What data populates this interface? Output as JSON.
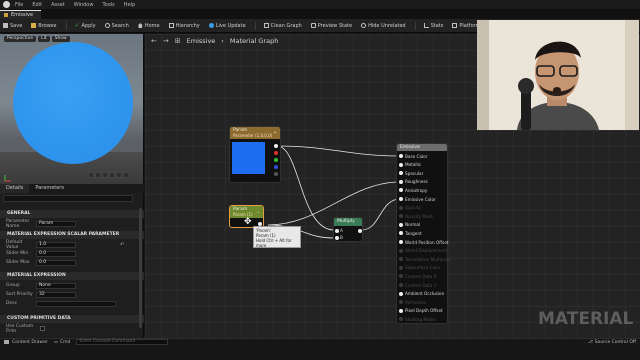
{
  "menu": {
    "items": [
      "File",
      "Edit",
      "Asset",
      "Window",
      "Tools",
      "Help"
    ]
  },
  "tab": {
    "title": "Emissive"
  },
  "toolbar": {
    "buttons": [
      {
        "label": "Save",
        "icon": "save-icon",
        "color": "#bfbfbf"
      },
      {
        "label": "Browse",
        "icon": "folder-icon",
        "color": "#d9b04a"
      },
      {
        "label": "Apply",
        "icon": "check-icon",
        "color": "#3bb24a"
      },
      {
        "label": "Search",
        "icon": "search-icon",
        "color": "#bfbfbf"
      },
      {
        "label": "Home",
        "icon": "home-icon",
        "color": "#bfbfbf"
      },
      {
        "label": "Hierarchy",
        "icon": "hierarchy-icon",
        "color": "#bfbfbf"
      },
      {
        "label": "Live Update",
        "icon": "live-update-icon",
        "color": "#3a9fe8"
      },
      {
        "label": "Clean Graph",
        "icon": "clean-graph-icon",
        "color": "#bfbfbf"
      },
      {
        "label": "Preview State",
        "icon": "preview-state-icon",
        "color": "#bfbfbf"
      },
      {
        "label": "Hide Unrelated",
        "icon": "hide-unrelated-icon",
        "color": "#bfbfbf"
      },
      {
        "label": "Stats",
        "icon": "stats-icon",
        "color": "#bfbfbf"
      },
      {
        "label": "Platform Stats",
        "icon": "platform-stats-icon",
        "color": "#bfbfbf"
      }
    ]
  },
  "viewport": {
    "pills": [
      "Perspective",
      "Lit",
      "Show"
    ],
    "sphere_color": "#2f96ee"
  },
  "details": {
    "tabs": [
      "Details",
      "Parameters"
    ],
    "sections": {
      "general": "GENERAL",
      "mes": "MATERIAL EXPRESSION SCALAR PARAMETER",
      "mep": "MATERIAL EXPRESSION",
      "cpd": "CUSTOM PRIMITIVE DATA"
    },
    "rows": {
      "param_name": {
        "label": "Parameter Name",
        "value": "Param"
      },
      "default_value": {
        "label": "Default Value",
        "value": "1.0"
      },
      "slider_min": {
        "label": "Slider Min",
        "value": "0.0"
      },
      "slider_max": {
        "label": "Slider Max",
        "value": "0.0"
      },
      "group": {
        "label": "Group",
        "value": "None"
      },
      "sort_priority": {
        "label": "Sort Priority",
        "value": "32"
      },
      "desc": {
        "label": "Desc",
        "value": ""
      },
      "use_custom": {
        "label": "Use Custom Prim",
        "value": ""
      }
    }
  },
  "graph": {
    "title": "Emissive",
    "sep": "›",
    "crumb": "Material Graph"
  },
  "nodes": {
    "vector_param": {
      "title": "Param",
      "subtitle": "Parameter (1,0,0,0)",
      "color": "#8d6a2e",
      "swatch": "#1e6df0"
    },
    "scalar_param": {
      "title": "Param",
      "subtitle": "Param (1)",
      "color": "#6e8a2c"
    },
    "multiply": {
      "title": "Multiply",
      "color": "#3a7a55",
      "in_a": "A",
      "in_b": "B"
    },
    "result": {
      "title": "Emissive",
      "color": "#6d6d6d",
      "pins": [
        {
          "label": "Base Color",
          "active": true
        },
        {
          "label": "Metallic",
          "active": true
        },
        {
          "label": "Specular",
          "active": true
        },
        {
          "label": "Roughness",
          "active": true
        },
        {
          "label": "Anisotropy",
          "active": true
        },
        {
          "label": "Emissive Color",
          "active": true
        },
        {
          "label": "Opacity",
          "active": false
        },
        {
          "label": "Opacity Mask",
          "active": false
        },
        {
          "label": "Normal",
          "active": true
        },
        {
          "label": "Tangent",
          "active": true
        },
        {
          "label": "World Position Offset",
          "active": true
        },
        {
          "label": "World Displacement",
          "active": false
        },
        {
          "label": "Tessellation Multiplier",
          "active": false
        },
        {
          "label": "Subsurface Color",
          "active": false
        },
        {
          "label": "Custom Data 0",
          "active": false
        },
        {
          "label": "Custom Data 1",
          "active": false
        },
        {
          "label": "Ambient Occlusion",
          "active": true
        },
        {
          "label": "Refraction",
          "active": false
        },
        {
          "label": "Pixel Depth Offset",
          "active": true
        },
        {
          "label": "Shading Model",
          "active": false
        }
      ]
    }
  },
  "tooltip": {
    "line1": "'Param'",
    "line2": "Param (1)",
    "line3": "Hold Ctrl + Alt for more"
  },
  "watermark": "MATERIAL",
  "status": {
    "drawer": "Content Drawer",
    "cmd": "Cmd",
    "console_placeholder": "Enter Console Command",
    "source": "Source Control Off"
  }
}
